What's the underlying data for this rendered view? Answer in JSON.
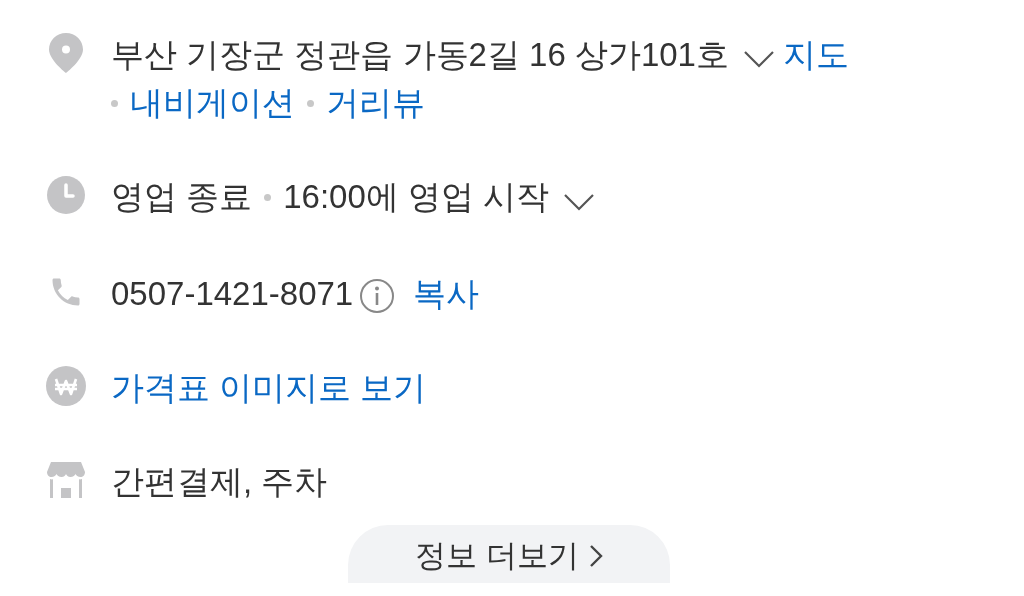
{
  "address": {
    "text": "부산 기장군 정관읍 가동2길 16 상가101호",
    "map_link": "지도",
    "links": [
      "내비게이션",
      "거리뷰"
    ]
  },
  "hours": {
    "status": "영업 종료",
    "detail": "16:00에 영업 시작"
  },
  "phone": {
    "number": "0507-1421-8071",
    "copy": "복사"
  },
  "price": {
    "link": "가격표 이미지로 보기"
  },
  "facilities": {
    "text": "간편결제, 주차"
  },
  "more_button": {
    "label": "정보 더보기"
  }
}
